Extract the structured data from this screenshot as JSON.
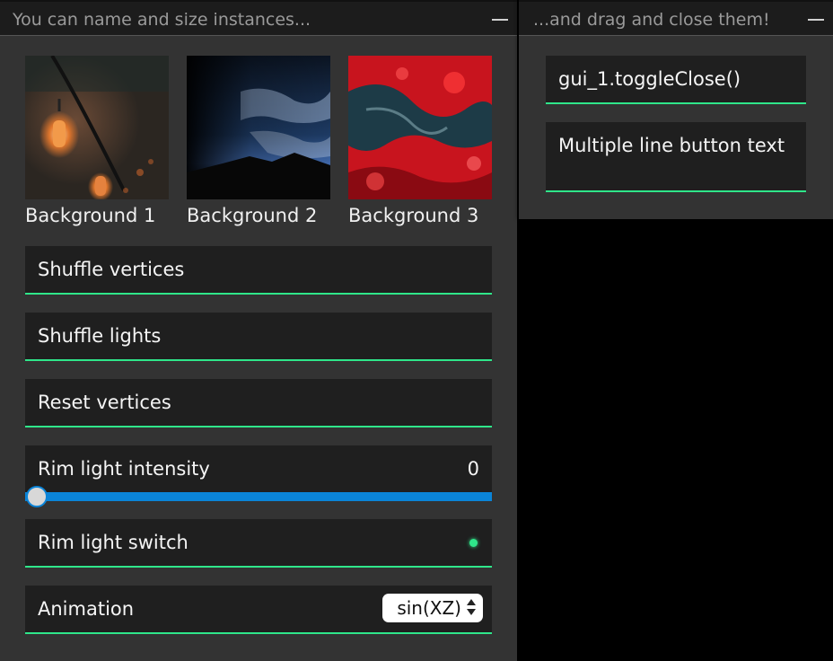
{
  "panel_left": {
    "title": "You can name and size instances...",
    "thumbnails": [
      {
        "caption": "Background 1"
      },
      {
        "caption": "Background 2"
      },
      {
        "caption": "Background 3"
      }
    ],
    "buttons": [
      "Shuffle vertices",
      "Shuffle lights",
      "Reset vertices"
    ],
    "slider": {
      "label": "Rim light intensity",
      "value": "0",
      "fraction": 0
    },
    "switch": {
      "label": "Rim light switch",
      "state": "on"
    },
    "select": {
      "label": "Animation",
      "value": "sin(XZ)"
    }
  },
  "panel_right": {
    "title": "...and drag and close them!",
    "buttons": [
      "gui_1.toggleClose()",
      "Multiple line button text"
    ]
  },
  "colors": {
    "accent": "#2fe68a",
    "slider_track": "#0a84d8",
    "panel_bg": "#333333",
    "control_bg": "#1f1f1f",
    "titlebar_bg": "#1c1c1c"
  }
}
